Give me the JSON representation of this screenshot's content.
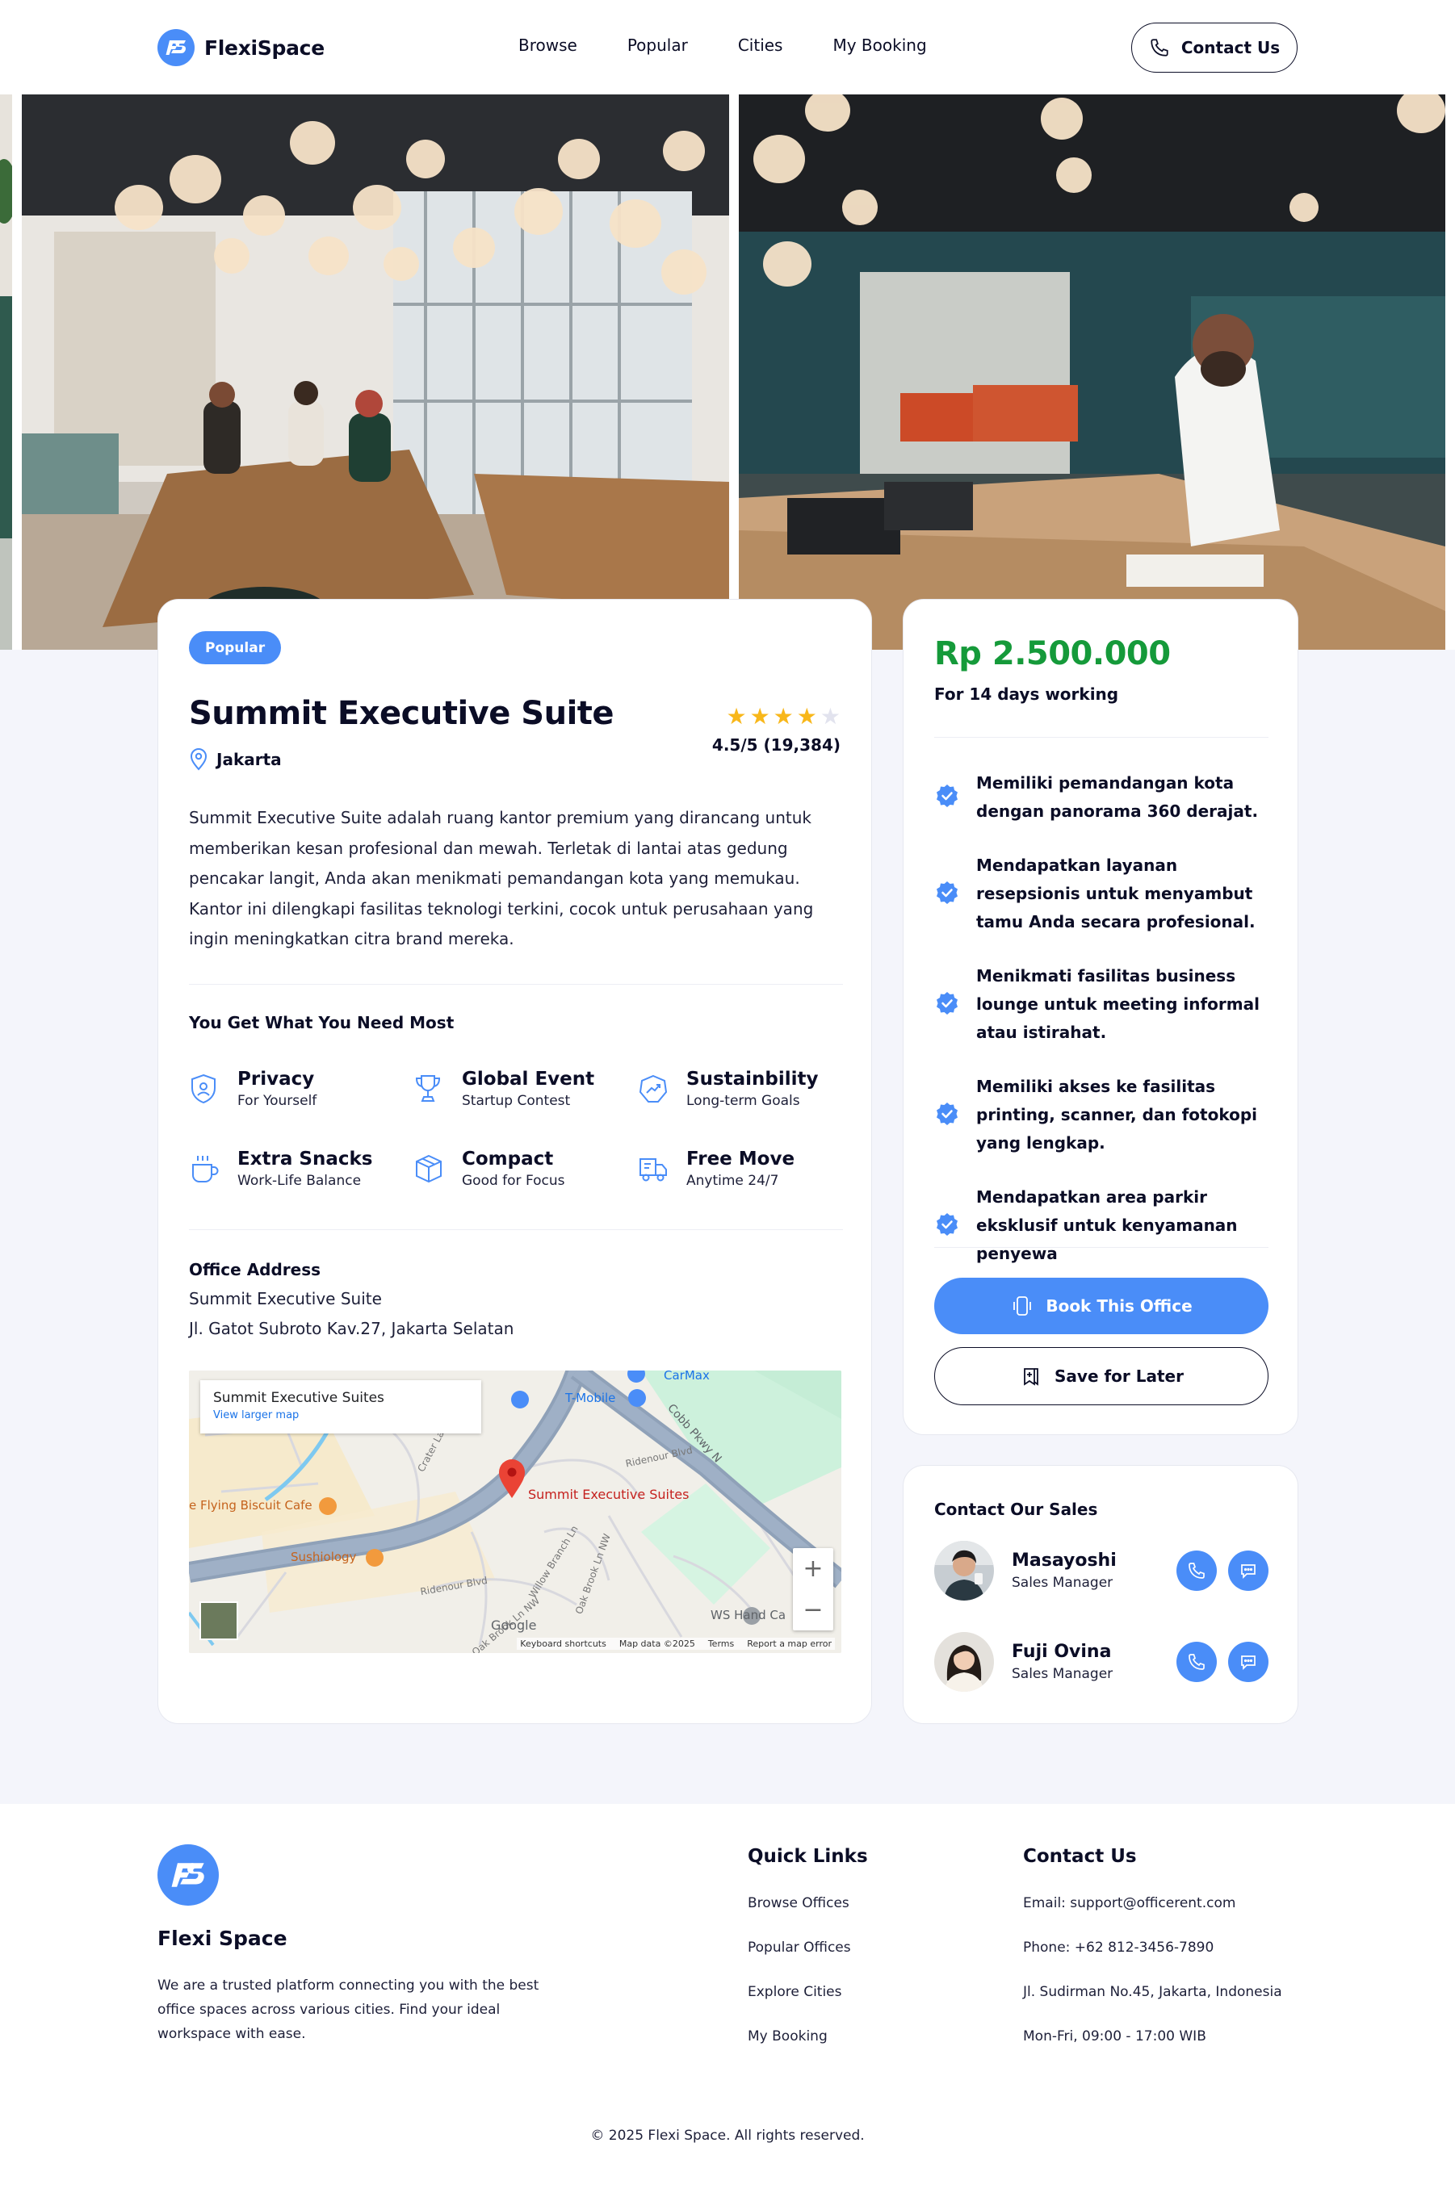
{
  "header": {
    "brand": "FlexiSpace",
    "nav": [
      "Browse",
      "Popular",
      "Cities",
      "My Booking"
    ],
    "contact_label": "Contact Us"
  },
  "office": {
    "badge": "Popular",
    "title": "Summit Executive Suite",
    "city": "Jakarta",
    "rating_stars": 4,
    "rating_text": "4.5/5 (19,384)",
    "description": "Summit Executive Suite adalah ruang kantor premium yang dirancang untuk memberikan kesan profesional dan mewah. Terletak di lantai atas gedung pencakar langit, Anda akan menikmati pemandangan kota yang memukau. Kantor ini dilengkapi fasilitas teknologi terkini, cocok untuk perusahaan yang ingin meningkatkan citra brand mereka.",
    "features_title": "You Get What You Need Most",
    "features": [
      {
        "name": "Privacy",
        "sub": "For Yourself",
        "icon": "shield-user-icon"
      },
      {
        "name": "Global Event",
        "sub": "Startup Contest",
        "icon": "trophy-icon"
      },
      {
        "name": "Sustainbility",
        "sub": "Long-term Goals",
        "icon": "trend-up-icon"
      },
      {
        "name": "Extra Snacks",
        "sub": "Work-Life Balance",
        "icon": "coffee-icon"
      },
      {
        "name": "Compact",
        "sub": "Good for Focus",
        "icon": "box-icon"
      },
      {
        "name": "Free Move",
        "sub": "Anytime 24/7",
        "icon": "truck-icon"
      }
    ],
    "address_title": "Office Address",
    "address_line1": "Summit Executive Suite",
    "address_line2": "Jl. Gatot Subroto Kav.27, Jakarta Selatan"
  },
  "map": {
    "card_title": "Summit Executive Suites",
    "card_link": "View larger map",
    "pin_label": "Summit Executive Suites",
    "places": [
      "CarMax",
      "T-Mobile",
      "e Flying Biscuit Cafe",
      "Sushiology",
      "WS Hand Ca"
    ],
    "roads": [
      "Cobb Pkwy N",
      "Ridenour Blvd",
      "Ridenour Blvd",
      "Crater Lak",
      "Willow Branch Ln",
      "Oak Brook Ln NW",
      "Oak Brook Ln NW"
    ],
    "google": "Google",
    "footer": [
      "Keyboard shortcuts",
      "Map data ©2025",
      "Terms",
      "Report a map error"
    ],
    "zoom_in": "+",
    "zoom_out": "−"
  },
  "pricing": {
    "price": "Rp 2.500.000",
    "period": "For 14 days working",
    "benefits": [
      "Memiliki pemandangan kota dengan panorama 360 derajat.",
      "Mendapatkan layanan resepsionis untuk menyambut tamu Anda secara profesional.",
      "Menikmati fasilitas business lounge untuk meeting informal atau istirahat.",
      "Memiliki akses ke fasilitas printing, scanner, dan fotokopi yang lengkap.",
      "Mendapatkan area parkir eksklusif untuk kenyamanan penyewa"
    ],
    "book_label": "Book This Office",
    "save_label": "Save for Later"
  },
  "sales": {
    "title": "Contact Our Sales",
    "people": [
      {
        "name": "Masayoshi",
        "role": "Sales Manager"
      },
      {
        "name": "Fuji Ovina",
        "role": "Sales Manager"
      }
    ]
  },
  "footer": {
    "brand": "Flexi Space",
    "about": "We are a trusted platform connecting you with the best office spaces across various cities. Find your ideal workspace with ease.",
    "quick_title": "Quick Links",
    "quick_links": [
      "Browse Offices",
      "Popular Offices",
      "Explore Cities",
      "My Booking"
    ],
    "contact_title": "Contact Us",
    "contact_lines": [
      "Email: support@officerent.com",
      "Phone: +62 812-3456-7890",
      "Jl. Sudirman No.45, Jakarta, Indonesia",
      "Mon-Fri, 09:00 - 17:00 WIB"
    ],
    "copyright": "© 2025 Flexi Space. All rights reserved."
  },
  "colors": {
    "accent": "#4a8df8",
    "price_green": "#159a3a",
    "star": "#f8b71a",
    "page_bg": "#f4f5fb"
  }
}
